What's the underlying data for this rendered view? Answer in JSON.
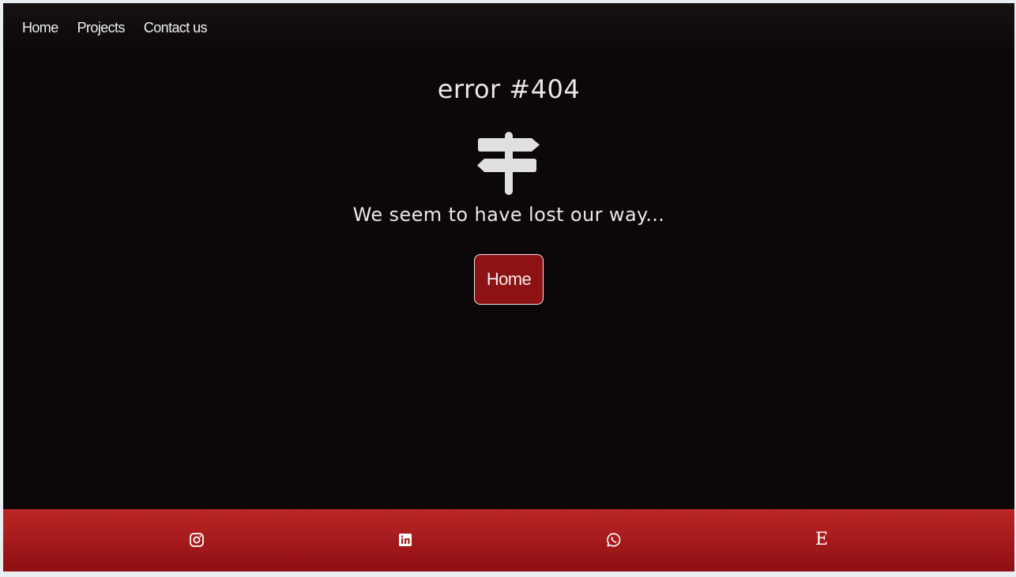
{
  "nav": {
    "items": [
      {
        "label": "Home"
      },
      {
        "label": "Projects"
      },
      {
        "label": "Contact us"
      }
    ]
  },
  "main": {
    "title": "error #404",
    "icon": "signpost-icon",
    "subtitle": "We seem to have lost our way...",
    "home_button_label": "Home"
  },
  "footer": {
    "links": [
      {
        "icon": "instagram-icon"
      },
      {
        "icon": "linkedin-icon"
      },
      {
        "icon": "whatsapp-icon"
      },
      {
        "icon": "etsy-icon",
        "glyph": "E"
      }
    ]
  },
  "colors": {
    "background": "#0c0708",
    "accent": "#8d1214",
    "footer_top": "#bb2626",
    "footer_bottom": "#8f0f12",
    "text": "#e8e8e8"
  }
}
